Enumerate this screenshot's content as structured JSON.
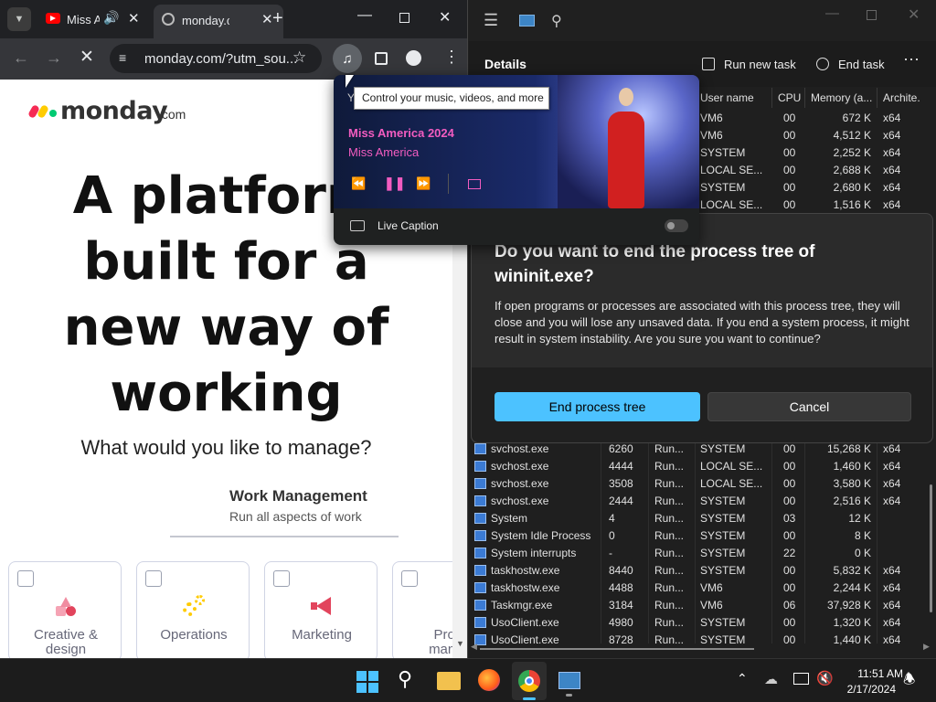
{
  "chrome": {
    "tabs": [
      {
        "title": "Miss A",
        "icon": "youtube-icon"
      },
      {
        "title": "monday.c",
        "icon": "monday-favicon-icon"
      }
    ],
    "address": "monday.com/?utm_sou..."
  },
  "tooltip": "Control your music, videos, and more",
  "media": {
    "title": "Miss America 2024",
    "artist": "Miss America",
    "live_caption": "Live Caption",
    "source_letter": "Y"
  },
  "monday": {
    "logo_text": "monday",
    "logo_suffix": ".com",
    "hero_lines": [
      "A platform",
      "built for a",
      "new way of",
      "working"
    ],
    "question": "What would you like to manage?",
    "tab_title": "Work Management",
    "tab_subtitle": "Run all aspects of work",
    "cards": [
      {
        "label": "Creative &\ndesign",
        "icon": "shapes-icon",
        "color": "#e2445c"
      },
      {
        "label": "Operations",
        "icon": "gears-icon",
        "color": "#ffcb00"
      },
      {
        "label": "Marketing",
        "icon": "megaphone-icon",
        "color": "#e2445c"
      },
      {
        "label": "Proje\nmanag",
        "icon": "project-icon",
        "color": "#a25ddc"
      }
    ]
  },
  "taskmanager": {
    "section": "Details",
    "run_new_task": "Run new task",
    "end_task": "End task",
    "columns": [
      "User name",
      "CPU",
      "Memory (a...",
      "Archite."
    ],
    "top_rows": [
      {
        "user": "VM6",
        "cpu": "00",
        "mem": "672 K",
        "arch": "x64"
      },
      {
        "user": "VM6",
        "cpu": "00",
        "mem": "4,512 K",
        "arch": "x64"
      },
      {
        "user": "SYSTEM",
        "cpu": "00",
        "mem": "2,252 K",
        "arch": "x64"
      },
      {
        "user": "LOCAL SE...",
        "cpu": "00",
        "mem": "2,688 K",
        "arch": "x64"
      },
      {
        "user": "SYSTEM",
        "cpu": "00",
        "mem": "2,680 K",
        "arch": "x64"
      },
      {
        "user": "LOCAL SE...",
        "cpu": "00",
        "mem": "1,516 K",
        "arch": "x64"
      }
    ],
    "rows": [
      {
        "name": "svchost.exe",
        "pid": "6260",
        "status": "Run...",
        "user": "SYSTEM",
        "cpu": "00",
        "mem": "15,268 K",
        "arch": "x64"
      },
      {
        "name": "svchost.exe",
        "pid": "4444",
        "status": "Run...",
        "user": "LOCAL SE...",
        "cpu": "00",
        "mem": "1,460 K",
        "arch": "x64"
      },
      {
        "name": "svchost.exe",
        "pid": "3508",
        "status": "Run...",
        "user": "LOCAL SE...",
        "cpu": "00",
        "mem": "3,580 K",
        "arch": "x64"
      },
      {
        "name": "svchost.exe",
        "pid": "2444",
        "status": "Run...",
        "user": "SYSTEM",
        "cpu": "00",
        "mem": "2,516 K",
        "arch": "x64"
      },
      {
        "name": "System",
        "pid": "4",
        "status": "Run...",
        "user": "SYSTEM",
        "cpu": "03",
        "mem": "12 K",
        "arch": ""
      },
      {
        "name": "System Idle Process",
        "pid": "0",
        "status": "Run...",
        "user": "SYSTEM",
        "cpu": "00",
        "mem": "8 K",
        "arch": ""
      },
      {
        "name": "System interrupts",
        "pid": "-",
        "status": "Run...",
        "user": "SYSTEM",
        "cpu": "22",
        "mem": "0 K",
        "arch": ""
      },
      {
        "name": "taskhostw.exe",
        "pid": "8440",
        "status": "Run...",
        "user": "SYSTEM",
        "cpu": "00",
        "mem": "5,832 K",
        "arch": "x64"
      },
      {
        "name": "taskhostw.exe",
        "pid": "4488",
        "status": "Run...",
        "user": "VM6",
        "cpu": "00",
        "mem": "2,244 K",
        "arch": "x64"
      },
      {
        "name": "Taskmgr.exe",
        "pid": "3184",
        "status": "Run...",
        "user": "VM6",
        "cpu": "06",
        "mem": "37,928 K",
        "arch": "x64"
      },
      {
        "name": "UsoClient.exe",
        "pid": "4980",
        "status": "Run...",
        "user": "SYSTEM",
        "cpu": "00",
        "mem": "1,320 K",
        "arch": "x64"
      },
      {
        "name": "UsoClient.exe",
        "pid": "8728",
        "status": "Run...",
        "user": "SYSTEM",
        "cpu": "00",
        "mem": "1,440 K",
        "arch": "x64"
      }
    ]
  },
  "dialog": {
    "title": "Do you want to end the process tree of wininit.exe?",
    "body": "If open programs or processes are associated with this process tree, they will close and you will lose any unsaved data. If you end a system process, it might result in system instability. Are you sure you want to continue?",
    "primary": "End process tree",
    "cancel": "Cancel",
    "accent": "#4cc2ff"
  },
  "taskbar": {
    "time": "11:51 AM",
    "date": "2/17/2024"
  }
}
